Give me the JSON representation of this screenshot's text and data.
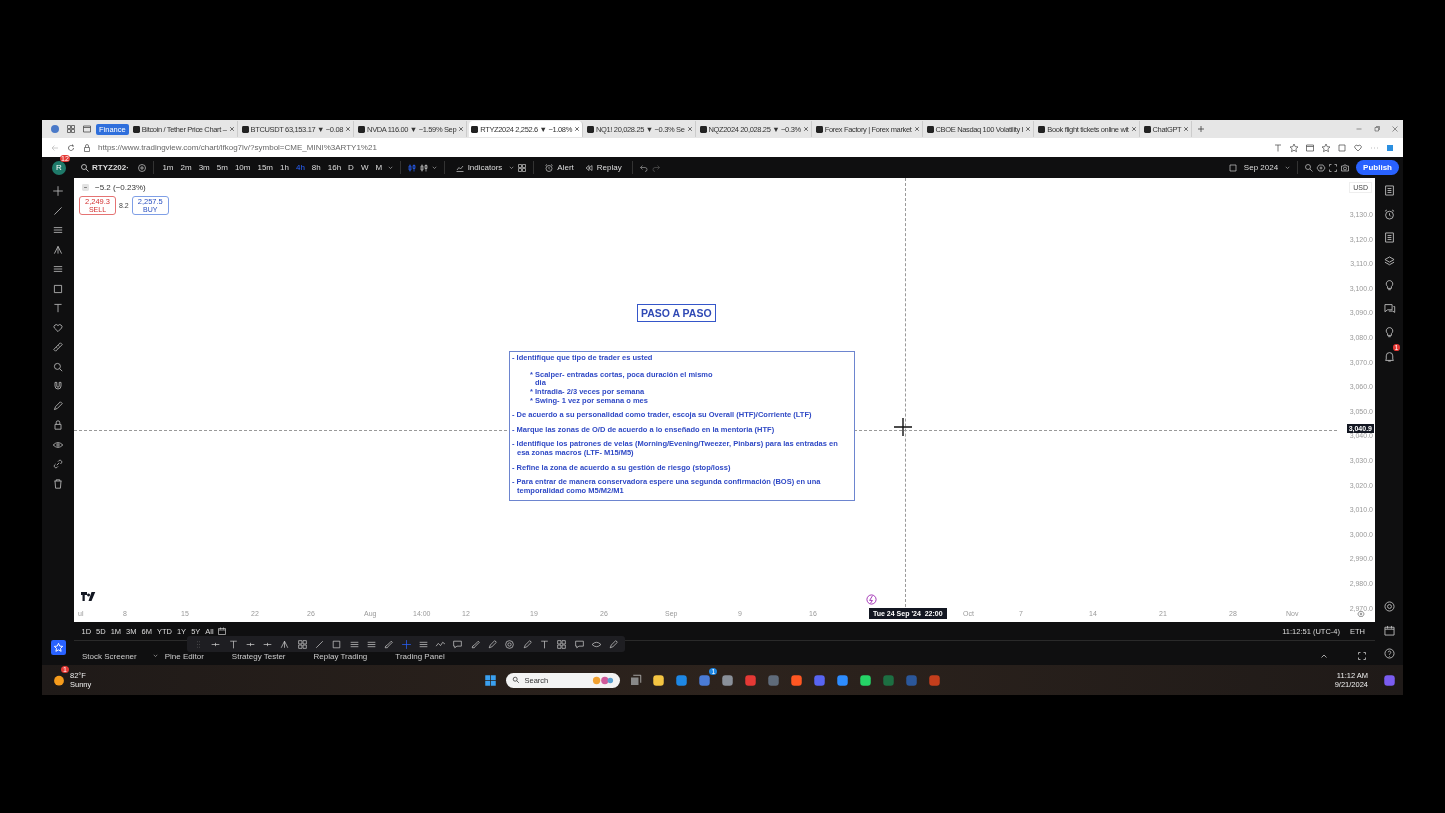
{
  "browser": {
    "tab_group": "Finance",
    "tabs": [
      {
        "title": "Bitcoin / Tether Price Chart –",
        "selected": false
      },
      {
        "title": "BTCUSDT 63,153.17 ▼ −0.08",
        "selected": false
      },
      {
        "title": "NVDA 116.00 ▼ −1.59% Sep",
        "selected": false
      },
      {
        "title": "RTYZ2024 2,252.6 ▼ −1.08%",
        "selected": true
      },
      {
        "title": "NQ1! 20,028.25 ▼ −0.3% Se",
        "selected": false
      },
      {
        "title": "NQZ2024 20,028.25 ▼ −0.3%",
        "selected": false
      },
      {
        "title": "Forex Factory | Forex market",
        "selected": false
      },
      {
        "title": "CBOE Nasdaq 100 Volatility I",
        "selected": false
      },
      {
        "title": "Book flight tickets online wit",
        "selected": false
      },
      {
        "title": "ChatGPT",
        "selected": false
      }
    ],
    "address": "https://www.tradingview.com/chart/lfkog7lv/?symbol=CME_MINI%3ARTY1%21"
  },
  "toolbar": {
    "avatar": "R",
    "badge": "12",
    "symbol": "RTYZ202·",
    "intervals": [
      {
        "label": "1m",
        "selected": false
      },
      {
        "label": "2m",
        "selected": false
      },
      {
        "label": "3m",
        "selected": false
      },
      {
        "label": "5m",
        "selected": false
      },
      {
        "label": "10m",
        "selected": false
      },
      {
        "label": "15m",
        "selected": false
      },
      {
        "label": "1h",
        "selected": false
      },
      {
        "label": "4h",
        "selected": true
      },
      {
        "label": "8h",
        "selected": false
      },
      {
        "label": "16h",
        "selected": false
      },
      {
        "label": "D",
        "selected": false
      },
      {
        "label": "W",
        "selected": false
      },
      {
        "label": "M",
        "selected": false
      }
    ],
    "indicators": "Indicators",
    "alert": "Alert",
    "replay": "Replay",
    "date_range": "Sep 2024",
    "publish": "Publish"
  },
  "chart": {
    "change": "−5.2 (−0.23%)",
    "sell_price": "2,249.3",
    "sell_label": "SELL",
    "spread": "8.2",
    "buy_price": "2,257.5",
    "buy_label": "BUY",
    "currency": "USD",
    "price_ticks": [
      "3,130.0",
      "3,120.0",
      "3,110.0",
      "3,100.0",
      "3,090.0",
      "3,080.0",
      "3,070.0",
      "3,060.0",
      "3,050.0",
      "3,040.0",
      "3,030.0",
      "3,020.0",
      "3,010.0",
      "3,000.0",
      "2,990.0",
      "2,980.0",
      "2,970.0"
    ],
    "crosshair_price": "3,040.9",
    "crosshair_time": "Tue 24 Sep '24  22:00",
    "time_ticks": [
      "ul",
      "8",
      "15",
      "22",
      "26",
      "Aug",
      "14:00",
      "12",
      "19",
      "26",
      "Sep",
      "9",
      "16",
      "Oct",
      "7",
      "14",
      "21",
      "28",
      "Nov"
    ],
    "title": "PASO A PASO",
    "notes": [
      {
        "kind": "main",
        "text": "- Identifique que tipo de trader es usted"
      },
      {
        "kind": "sub",
        "text": "* Scalper- entradas cortas, poca duración el mismo dia"
      },
      {
        "kind": "sub",
        "text": "* Intradia- 2/3 veces por semana"
      },
      {
        "kind": "sub",
        "text": "* Swing- 1 vez por semana o mes"
      },
      {
        "kind": "main",
        "text": "- De acuerdo a su personalidad como trader, escoja su Overall (HTF)/Corriente (LTF)"
      },
      {
        "kind": "main",
        "text": "- Marque las zonas de O/D de acuerdo a lo enseñado en la mentoria (HTF)"
      },
      {
        "kind": "main",
        "text": "- Identifique los patrones de velas (Morning/Evening/Tweezer, Pinbars) para las entradas en esa zonas macros (LTF- M15/M5)"
      },
      {
        "kind": "main",
        "text": "- Refine la zona de acuerdo a su gestión de riesgo (stop/loss)"
      },
      {
        "kind": "main",
        "text": "- Para entrar de manera conservadora espere una segunda confirmación (BOS) en una temporalidad como M5/M2/M1"
      }
    ]
  },
  "ranges": [
    "1D",
    "5D",
    "1M",
    "3M",
    "6M",
    "YTD",
    "1Y",
    "5Y",
    "All"
  ],
  "clock": "11:12:51 (UTC-4)",
  "session": "ETH",
  "panel_tabs": [
    "Stock Screener",
    "Pine Editor",
    "Strategy Tester",
    "Replay Trading",
    "Trading Panel"
  ],
  "alerts_badge": "1",
  "taskbar": {
    "temperature": "82°F",
    "weather": "Sunny",
    "weather_badge": "1",
    "search": "Search",
    "store_badge": "1",
    "time": "11:12 AM",
    "date": "9/21/2024"
  }
}
